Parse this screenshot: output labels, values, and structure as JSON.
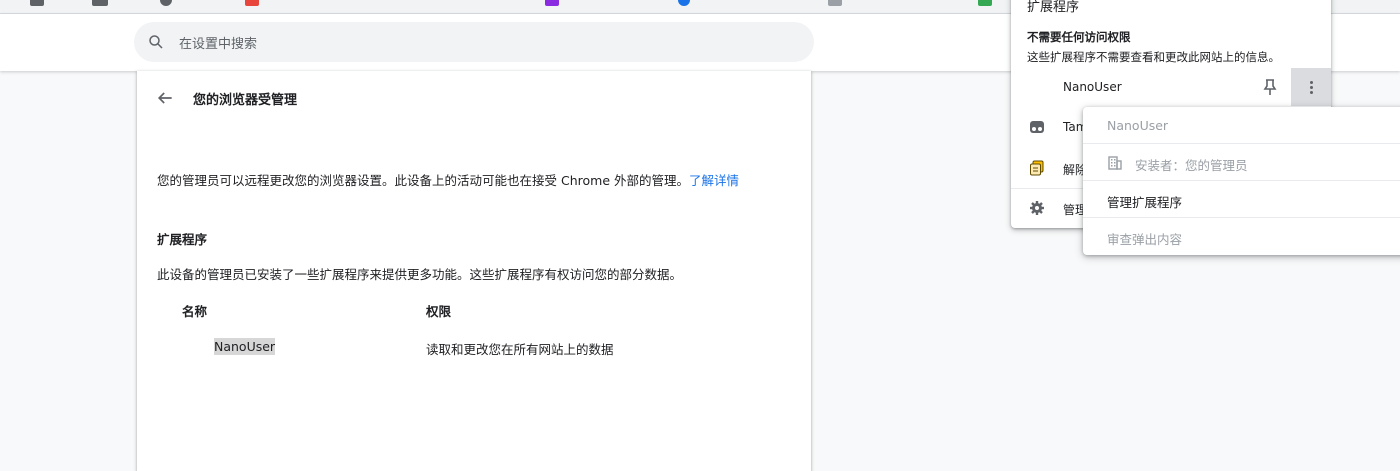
{
  "search": {
    "placeholder": "在设置中搜索"
  },
  "page": {
    "title": "您的浏览器受管理",
    "description": "您的管理员可以远程更改您的浏览器设置。此设备上的活动可能也在接受 Chrome 外部的管理。",
    "learn_more": "了解详情",
    "extensions_title": "扩展程序",
    "extensions_desc": "此设备的管理员已安装了一些扩展程序来提供更多功能。这些扩展程序有权访问您的部分数据。",
    "table": {
      "headers": [
        "名称",
        "权限"
      ],
      "rows": [
        {
          "name": "NanoUser",
          "permission": "读取和更改您在所有网站上的数据"
        }
      ]
    }
  },
  "extensions_popup": {
    "title": "扩展程序",
    "no_access_title": "不需要任何访问权限",
    "no_access_desc": "这些扩展程序不需要查看和更改此网站上的信息。",
    "items": [
      {
        "label": "NanoUser",
        "icon": "none"
      },
      {
        "label": "Tam",
        "icon": "tampermonkey-icon"
      },
      {
        "label": "解除",
        "icon": "copy-icon"
      },
      {
        "label": "管理",
        "icon": "gear-icon"
      }
    ]
  },
  "context_menu": {
    "items": [
      {
        "label": "NanoUser",
        "disabled": true
      },
      {
        "label": "安装者：您的管理员",
        "disabled": true,
        "icon": "building-icon"
      },
      {
        "label": "管理扩展程序",
        "disabled": false
      },
      {
        "label": "审查弹出内容",
        "disabled": true
      }
    ]
  }
}
